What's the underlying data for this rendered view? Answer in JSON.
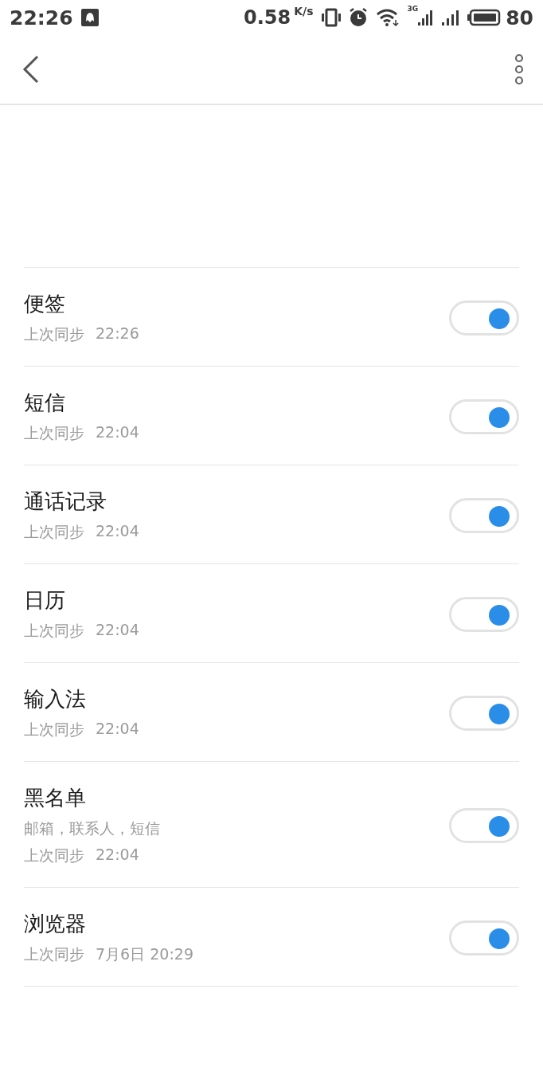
{
  "status_bar": {
    "time": "22:26",
    "speed": "0.58",
    "speed_unit": "K/s",
    "network": "3G",
    "battery": "80"
  },
  "sync_items": [
    {
      "title": "便签",
      "sync_label": "上次同步",
      "sync_time": "22:26",
      "on": true
    },
    {
      "title": "短信",
      "sync_label": "上次同步",
      "sync_time": "22:04",
      "on": true
    },
    {
      "title": "通话记录",
      "sync_label": "上次同步",
      "sync_time": "22:04",
      "on": true
    },
    {
      "title": "日历",
      "sync_label": "上次同步",
      "sync_time": "22:04",
      "on": true
    },
    {
      "title": "输入法",
      "sync_label": "上次同步",
      "sync_time": "22:04",
      "on": true
    },
    {
      "title": "黑名单",
      "details": "邮箱，联系人，短信",
      "sync_label": "上次同步",
      "sync_time": "22:04",
      "on": true
    },
    {
      "title": "浏览器",
      "sync_label": "上次同步",
      "sync_time": "7月6日 20:29",
      "on": true
    }
  ]
}
